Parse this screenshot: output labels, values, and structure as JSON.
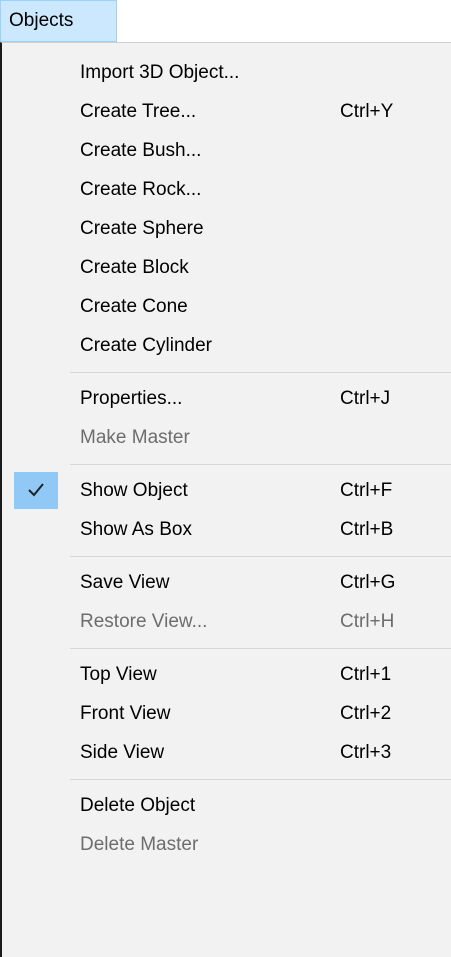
{
  "menubar": {
    "objects_label": "Objects"
  },
  "menu": {
    "items": [
      {
        "label": "Import 3D Object...",
        "shortcut": ""
      },
      {
        "label": "Create Tree...",
        "shortcut": "Ctrl+Y"
      },
      {
        "label": "Create Bush...",
        "shortcut": ""
      },
      {
        "label": "Create Rock...",
        "shortcut": ""
      },
      {
        "label": "Create Sphere",
        "shortcut": ""
      },
      {
        "label": "Create Block",
        "shortcut": ""
      },
      {
        "label": "Create Cone",
        "shortcut": ""
      },
      {
        "label": "Create Cylinder",
        "shortcut": ""
      },
      {
        "label": "Properties...",
        "shortcut": "Ctrl+J"
      },
      {
        "label": "Make Master",
        "shortcut": "",
        "disabled": true
      },
      {
        "label": "Show Object",
        "shortcut": "Ctrl+F",
        "checked": true
      },
      {
        "label": "Show As Box",
        "shortcut": "Ctrl+B"
      },
      {
        "label": "Save View",
        "shortcut": "Ctrl+G"
      },
      {
        "label": "Restore View...",
        "shortcut": "Ctrl+H",
        "disabled": true
      },
      {
        "label": "Top View",
        "shortcut": "Ctrl+1"
      },
      {
        "label": "Front View",
        "shortcut": "Ctrl+2"
      },
      {
        "label": "Side View",
        "shortcut": "Ctrl+3"
      },
      {
        "label": "Delete Object",
        "shortcut": ""
      },
      {
        "label": "Delete Master",
        "shortcut": "",
        "disabled": true
      }
    ]
  },
  "colors": {
    "menubar_highlight": "#cce8ff",
    "check_highlight": "#90c8f6",
    "disabled_text": "#6d6d6d",
    "menu_background": "#f2f2f2"
  },
  "icons": {
    "check": "checkmark-icon"
  }
}
